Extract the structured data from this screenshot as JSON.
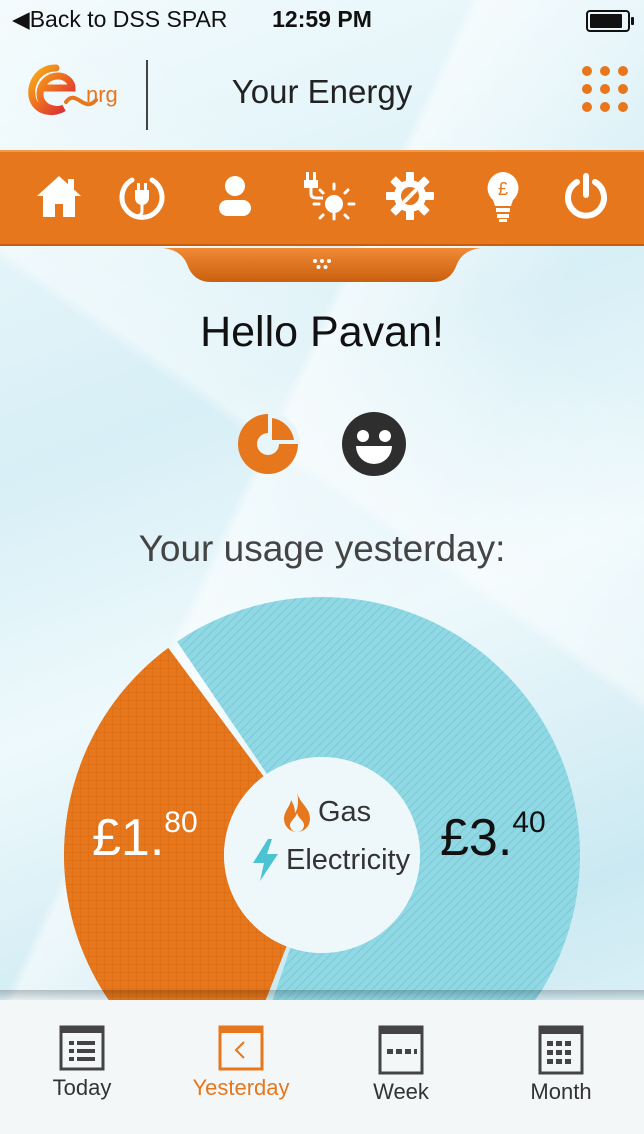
{
  "status_bar": {
    "back_label": "Back to DSS SPAR",
    "time": "12:59 PM",
    "battery_level": 0.9
  },
  "header": {
    "logo_text": "nrg",
    "title": "Your Energy"
  },
  "nav": {
    "items": [
      {
        "name": "home-icon"
      },
      {
        "name": "plug-icon"
      },
      {
        "name": "user-icon"
      },
      {
        "name": "solar-plug-icon"
      },
      {
        "name": "settings-gear-icon"
      },
      {
        "name": "lightbulb-pound-icon"
      },
      {
        "name": "power-icon"
      }
    ]
  },
  "greeting": "Hello Pavan!",
  "usage_title": "Your usage yesterday:",
  "chart_data": {
    "type": "pie",
    "slices": [
      {
        "label": "Gas",
        "value": 1.8,
        "display_main": "£1.",
        "display_pence": "80",
        "color": "#e6771c"
      },
      {
        "label": "Electricity",
        "value": 3.4,
        "display_main": "£3.",
        "display_pence": "40",
        "color": "#8fd8e4"
      }
    ]
  },
  "legend": {
    "gas": "Gas",
    "electricity": "Electricity"
  },
  "bottom_tabs": [
    {
      "label": "Today",
      "active": false
    },
    {
      "label": "Yesterday",
      "active": true
    },
    {
      "label": "Week",
      "active": false
    },
    {
      "label": "Month",
      "active": false
    }
  ],
  "colors": {
    "accent": "#e6771c",
    "electric": "#8fd8e4",
    "electric_icon": "#4bc3d3"
  }
}
